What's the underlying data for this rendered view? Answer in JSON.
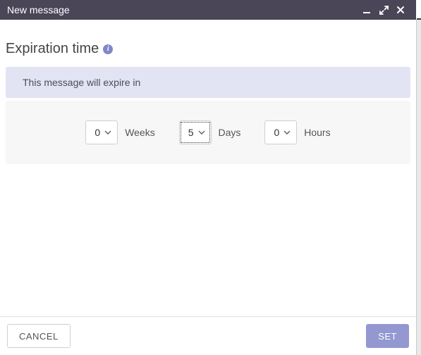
{
  "titlebar": {
    "title": "New message"
  },
  "heading": "Expiration time",
  "banner": "This message will expire in",
  "units": {
    "weeks": {
      "value": "0",
      "label": "Weeks"
    },
    "days": {
      "value": "5",
      "label": "Days"
    },
    "hours": {
      "value": "0",
      "label": "Hours"
    }
  },
  "footer": {
    "cancel": "CANCEL",
    "set": "SET"
  }
}
